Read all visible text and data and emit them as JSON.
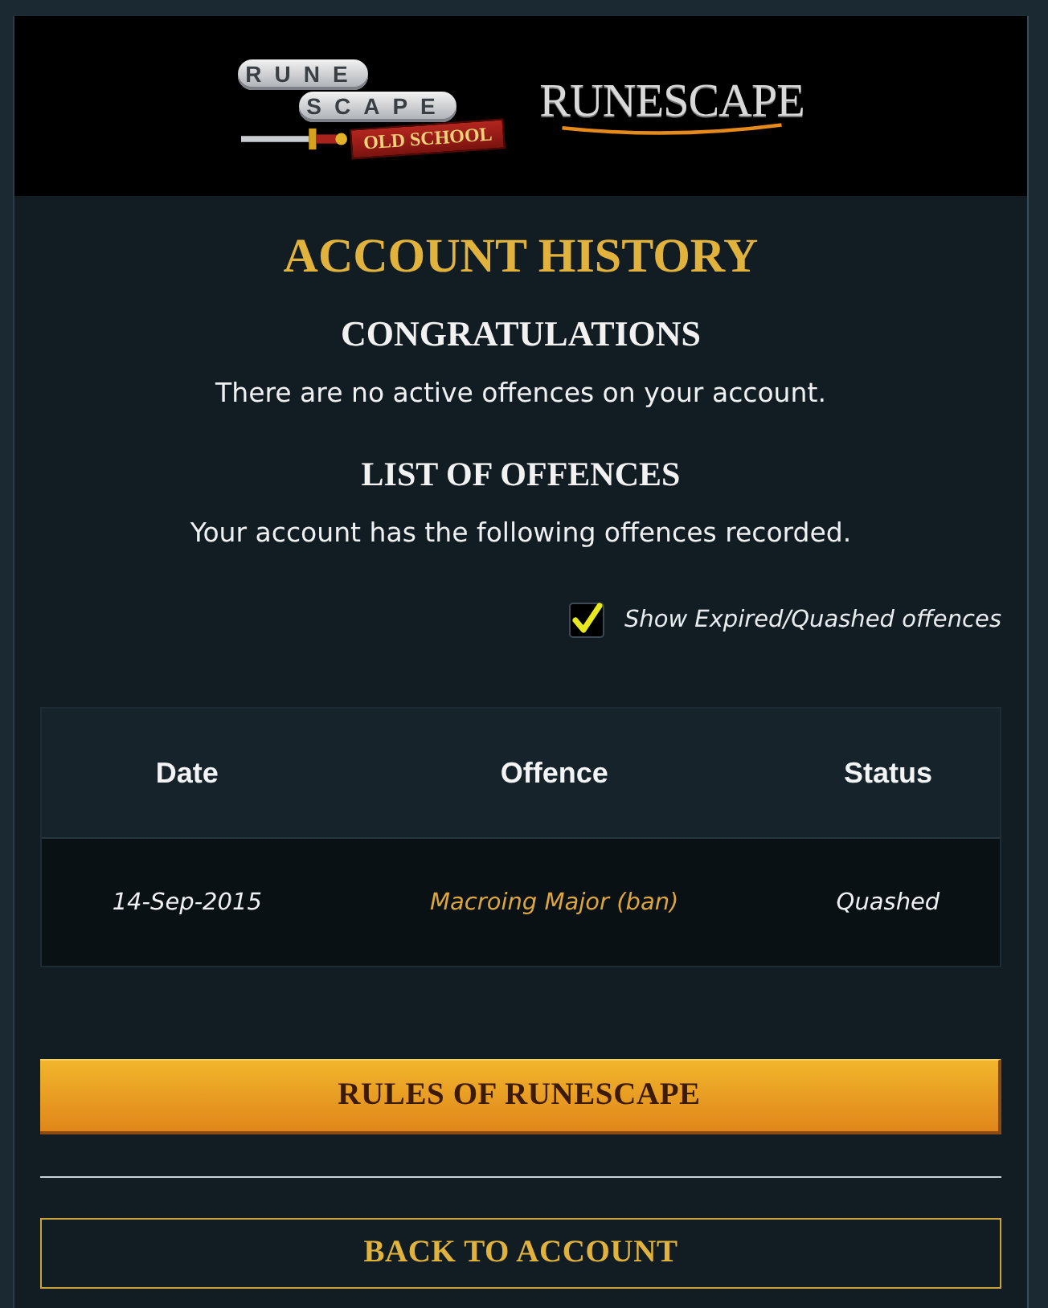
{
  "header": {
    "logos": [
      {
        "kind": "old_school",
        "stones": [
          "RUNE",
          "SCAPE"
        ],
        "banner": "OLD SCHOOL"
      },
      {
        "kind": "main",
        "text": "RUNESCAPE"
      }
    ]
  },
  "page": {
    "title": "ACCOUNT HISTORY"
  },
  "sections": [
    {
      "heading": "CONGRATULATIONS",
      "text": "There are no active offences on your account."
    },
    {
      "heading": "LIST OF OFFENCES",
      "text": "Your account has the following offences recorded."
    }
  ],
  "filter": {
    "label": "Show Expired/Quashed offences",
    "checked": true
  },
  "table": {
    "columns": [
      "Date",
      "Offence",
      "Status"
    ],
    "rows": [
      {
        "cells": [
          "14-Sep-2015",
          "Macroing Major (ban)",
          "Quashed"
        ]
      }
    ]
  },
  "buttons": [
    {
      "kind": "primary",
      "label": "RULES OF RUNESCAPE"
    },
    {
      "kind": "outline",
      "label": "BACK TO ACCOUNT"
    }
  ]
}
